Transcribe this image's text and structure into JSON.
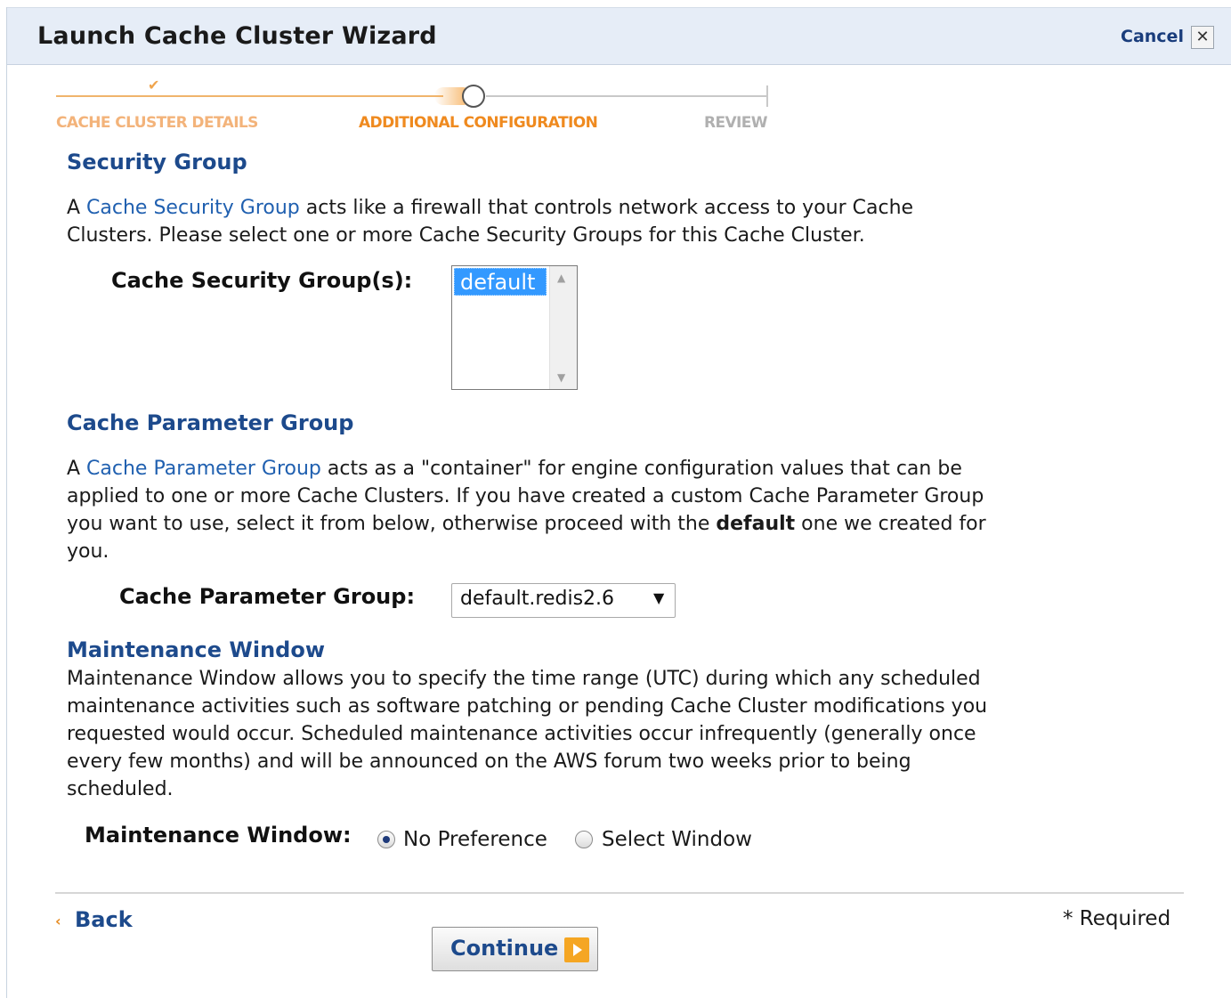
{
  "header": {
    "title": "Launch Cache Cluster Wizard",
    "cancel_label": "Cancel",
    "close_glyph": "✕"
  },
  "steps": [
    {
      "label": "CACHE CLUSTER DETAILS",
      "status": "completed"
    },
    {
      "label": "ADDITIONAL CONFIGURATION",
      "status": "current"
    },
    {
      "label": "REVIEW",
      "status": "pending"
    }
  ],
  "security_group": {
    "title": "Security Group",
    "desc_prefix": "A ",
    "desc_link": "Cache Security Group",
    "desc_line1_rest": " acts like a firewall that controls network access to your Cache",
    "desc_line2": "Clusters. Please select one or more Cache Security Groups for this Cache Cluster.",
    "field_label": "Cache Security Group(s):",
    "options": [
      "default"
    ],
    "selected": "default"
  },
  "parameter_group": {
    "title": "Cache Parameter Group",
    "desc_prefix": "A ",
    "desc_link": "Cache Parameter Group",
    "desc_line1_rest": " acts as a \"container\" for engine configuration values that can be",
    "desc_line2": "applied to one or more Cache Clusters. If you have created a custom Cache Parameter Group",
    "desc_line3_a": "you want to use, select it from below, otherwise proceed with the ",
    "desc_line3_bold": "default",
    "desc_line3_b": " one we created for",
    "desc_line4": "you.",
    "field_label": "Cache Parameter Group:",
    "selected": "default.redis2.6"
  },
  "maintenance": {
    "title": "Maintenance Window",
    "desc_line1": "Maintenance Window allows you to specify the time range (UTC) during which any scheduled",
    "desc_line2": "maintenance activities such as software patching or pending Cache Cluster modifications you",
    "desc_line3": "requested would occur. Scheduled maintenance activities occur infrequently (generally once",
    "desc_line4": "every few months) and will be announced on the AWS forum two weeks prior to being",
    "desc_line5": "scheduled.",
    "field_label": "Maintenance Window:",
    "options": [
      {
        "label": "No Preference",
        "checked": true
      },
      {
        "label": "Select Window",
        "checked": false
      }
    ]
  },
  "footer": {
    "back_label": "Back",
    "back_glyph": "‹",
    "required_label": "* Required",
    "continue_label": "Continue"
  },
  "colors": {
    "accent": "#1d4a8c",
    "link": "#2060b0",
    "step_active": "#ef8a1f",
    "continue_icon": "#f5a623"
  }
}
